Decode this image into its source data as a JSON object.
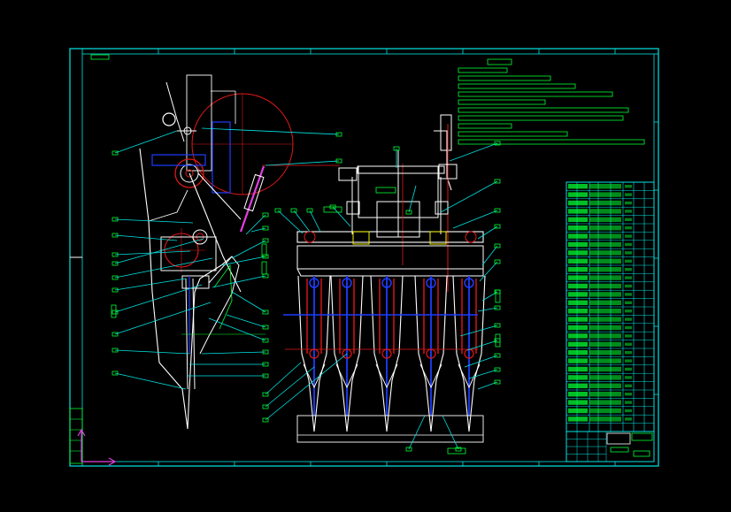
{
  "drawing": {
    "background_color": "#000000",
    "frame_color": "#00e5e5",
    "leader_color": "#00e5e5",
    "label_color": "#00ff33",
    "part_color": "#ffffff",
    "centerline_color": "#e01818",
    "hidden_color": "#1e3cff",
    "axis_color": "#e040e0"
  },
  "views": {
    "side_view": "side-elevation-view",
    "front_view": "front-elevation-view"
  },
  "notes_block": {
    "line_count": 10
  },
  "parts_list": {
    "row_count": 30,
    "column_count": 7
  },
  "title_block": {
    "row_count": 4
  },
  "ucs_icon": "ucs-axis-icon"
}
